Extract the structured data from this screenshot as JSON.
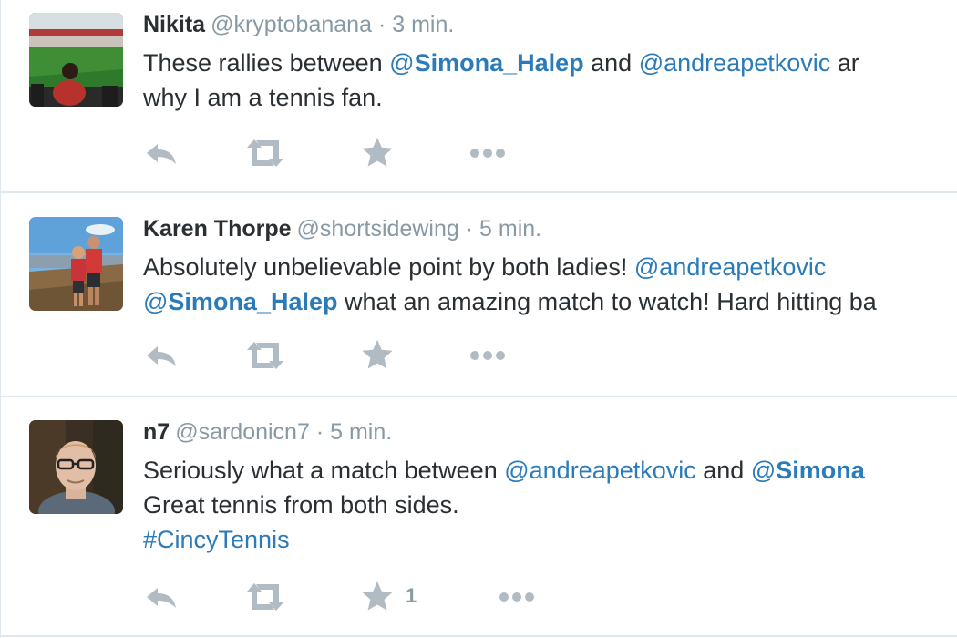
{
  "tweets": [
    {
      "fullname": "Nikita",
      "username": "@kryptobanana",
      "separator": "·",
      "time": "3 min.",
      "lines": [
        [
          {
            "type": "text",
            "text": "These rallies between "
          },
          {
            "type": "mention",
            "at": "@",
            "name": "Simona_Halep",
            "bold": true
          },
          {
            "type": "text",
            "text": " and "
          },
          {
            "type": "mention",
            "at": "@",
            "name": "andreapetkovic",
            "bold": false
          },
          {
            "type": "text",
            "text": " ar"
          }
        ],
        [
          {
            "type": "text",
            "text": "why I am a tennis fan."
          }
        ]
      ],
      "favorite_count": ""
    },
    {
      "fullname": "Karen Thorpe",
      "username": "@shortsidewing",
      "separator": "·",
      "time": "5 min.",
      "lines": [
        [
          {
            "type": "text",
            "text": "Absolutely unbelievable point by both ladies! "
          },
          {
            "type": "mention",
            "at": "@",
            "name": "andreapetkovic",
            "bold": false
          }
        ],
        [
          {
            "type": "mention",
            "at": "@",
            "name": "Simona_Halep",
            "bold": true
          },
          {
            "type": "text",
            "text": " what an amazing match to watch! Hard hitting ba"
          }
        ]
      ],
      "favorite_count": ""
    },
    {
      "fullname": "n7",
      "username": "@sardonicn7",
      "separator": "·",
      "time": "5 min.",
      "lines": [
        [
          {
            "type": "text",
            "text": "Seriously what a match between "
          },
          {
            "type": "mention",
            "at": "@",
            "name": "andreapetkovic",
            "bold": false
          },
          {
            "type": "text",
            "text": " and "
          },
          {
            "type": "mention",
            "at": "@",
            "name": "Simona",
            "bold": true
          }
        ],
        [
          {
            "type": "text",
            "text": "Great tennis from both sides."
          }
        ],
        [
          {
            "type": "hashtag",
            "text": "#CincyTennis"
          }
        ]
      ],
      "favorite_count": "1"
    }
  ],
  "icons": {
    "reply": "reply-arrow-icon",
    "retweet": "retweet-icon",
    "favorite": "star-icon",
    "more": "more-dots-icon"
  },
  "colors": {
    "link": "#2b7bb9",
    "secondary_text": "#8899a6",
    "action_icon": "#b1bbc3",
    "divider": "#e1e8ed"
  }
}
